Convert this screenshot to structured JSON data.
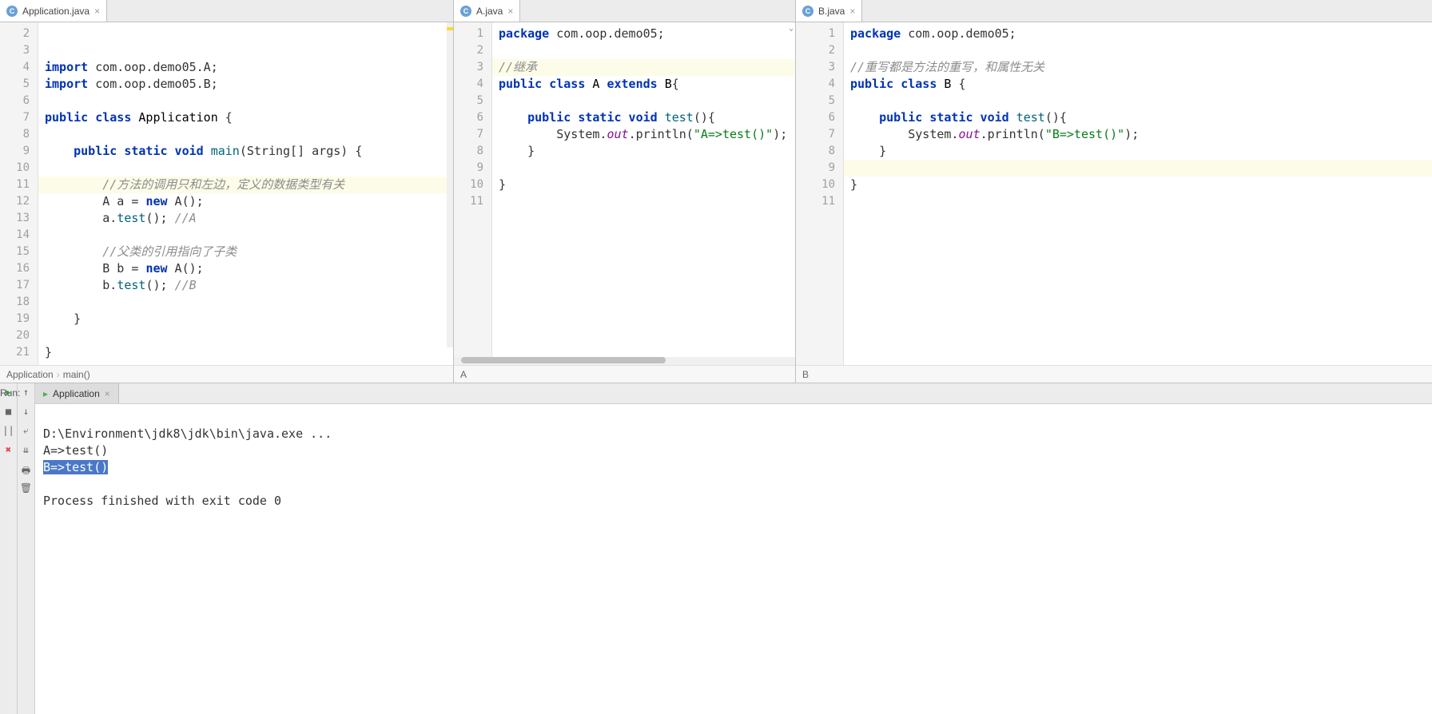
{
  "tabs": {
    "app": "Application.java",
    "a": "A.java",
    "b": "B.java"
  },
  "pane1": {
    "lines": [
      "2",
      "3",
      "4",
      "5",
      "6",
      "7",
      "8",
      "9",
      "10",
      "11",
      "12",
      "13",
      "14",
      "15",
      "16",
      "17",
      "18",
      "19",
      "20",
      "21"
    ],
    "code": {
      "l4a": "import",
      "l4b": " com.oop.demo05.A;",
      "l5a": "import",
      "l5b": " com.oop.demo05.B;",
      "l7a": "public class ",
      "l7b": "Application",
      "l7c": " {",
      "l9a": "    public static void ",
      "l9b": "main",
      "l9c": "(String[] args) {",
      "l11": "        //方法的调用只和左边，定义的数据类型有关",
      "l12a": "        A a = ",
      "l12b": "new",
      "l12c": " A();",
      "l13a": "        a.",
      "l13b": "test",
      "l13c": "(); ",
      "l13d": "//A",
      "l15": "        //父类的引用指向了子类",
      "l16a": "        B b = ",
      "l16b": "new",
      "l16c": " A();",
      "l17a": "        b.",
      "l17b": "test",
      "l17c": "(); ",
      "l17d": "//B",
      "l19": "    }",
      "l21": "}"
    },
    "breadcrumb": {
      "cls": "Application",
      "mth": "main()"
    }
  },
  "pane2": {
    "lines": [
      "1",
      "2",
      "3",
      "4",
      "5",
      "6",
      "7",
      "8",
      "9",
      "10",
      "11"
    ],
    "code": {
      "l1a": "package",
      "l1b": " com.oop.demo05;",
      "l3": "//继承",
      "l4a": "public class ",
      "l4b": "A",
      "l4c": " extends ",
      "l4d": "B",
      "l4e": "{",
      "l6a": "    public static void ",
      "l6b": "test",
      "l6c": "(){",
      "l7a": "        System.",
      "l7b": "out",
      "l7c": ".println(",
      "l7d": "\"A=>test()\"",
      "l7e": ");",
      "l8": "    }",
      "l10": "}"
    },
    "breadcrumb": "A"
  },
  "pane3": {
    "lines": [
      "1",
      "2",
      "3",
      "4",
      "5",
      "6",
      "7",
      "8",
      "9",
      "10",
      "11"
    ],
    "code": {
      "l1a": "package",
      "l1b": " com.oop.demo05;",
      "l3": "//重写都是方法的重写，和属性无关",
      "l4a": "public class ",
      "l4b": "B",
      "l4c": " {",
      "l6a": "    public static void ",
      "l6b": "test",
      "l6c": "(){",
      "l7a": "        System.",
      "l7b": "out",
      "l7c": ".println(",
      "l7d": "\"B=>test()\"",
      "l7e": ");",
      "l8": "    }",
      "l9": "",
      "l10": "}"
    },
    "breadcrumb": "B"
  },
  "run": {
    "label": "Run:",
    "tab": "Application",
    "out1": "D:\\Environment\\jdk8\\jdk\\bin\\java.exe ...",
    "out2": "A=>test()",
    "out3": "B=>test()",
    "out4": "",
    "out5": "Process finished with exit code 0"
  },
  "icons": {
    "close": "×",
    "c": "C"
  }
}
